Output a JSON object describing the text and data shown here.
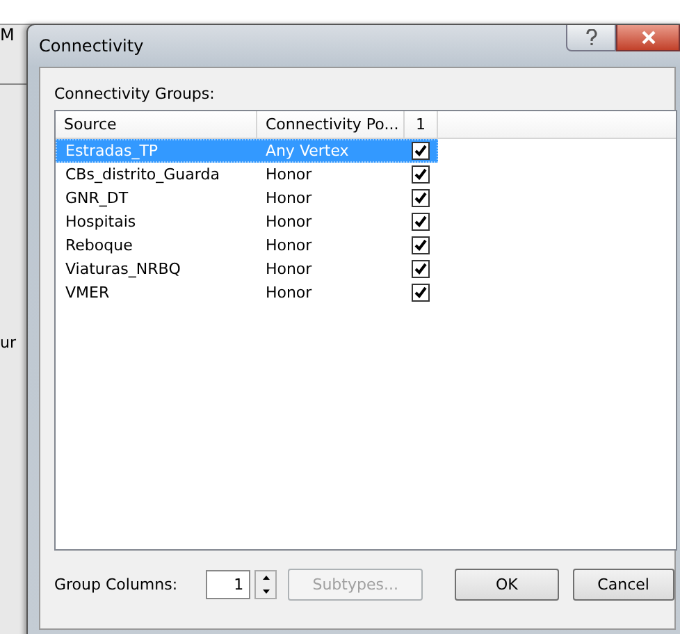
{
  "background_window": {
    "title": "M",
    "side_text": "ur"
  },
  "window": {
    "title": "Connectivity"
  },
  "groups_label": "Connectivity Groups:",
  "table": {
    "columns": [
      "Source",
      "Connectivity Po...",
      "1"
    ],
    "rows": [
      {
        "source": "Estradas_TP",
        "policy": "Any Vertex",
        "checked": true,
        "selected": true
      },
      {
        "source": "CBs_distrito_Guarda",
        "policy": "Honor",
        "checked": true,
        "selected": false
      },
      {
        "source": "GNR_DT",
        "policy": "Honor",
        "checked": true,
        "selected": false
      },
      {
        "source": "Hospitais",
        "policy": "Honor",
        "checked": true,
        "selected": false
      },
      {
        "source": "Reboque",
        "policy": "Honor",
        "checked": true,
        "selected": false
      },
      {
        "source": "Viaturas_NRBQ",
        "policy": "Honor",
        "checked": true,
        "selected": false
      },
      {
        "source": "VMER",
        "policy": "Honor",
        "checked": true,
        "selected": false
      }
    ]
  },
  "group_columns": {
    "label": "Group Columns:",
    "value": "1"
  },
  "buttons": [
    {
      "label": "Subtypes...",
      "disabled": true
    },
    {
      "label": "OK",
      "disabled": false
    },
    {
      "label": "Cancel",
      "disabled": false
    }
  ]
}
